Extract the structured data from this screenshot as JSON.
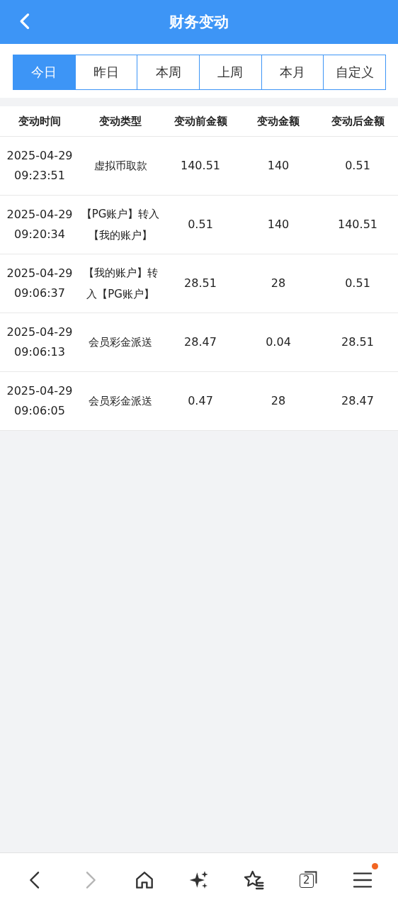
{
  "header": {
    "title": "财务变动"
  },
  "tabs": [
    {
      "label": "今日",
      "selected": true
    },
    {
      "label": "昨日",
      "selected": false
    },
    {
      "label": "本周",
      "selected": false
    },
    {
      "label": "上周",
      "selected": false
    },
    {
      "label": "本月",
      "selected": false
    },
    {
      "label": "自定义",
      "selected": false
    }
  ],
  "table": {
    "columns": [
      "变动时间",
      "变动类型",
      "变动前金额",
      "变动金额",
      "变动后金额"
    ],
    "rows": [
      [
        "2025-04-29 09:23:51",
        "虚拟币取款",
        "140.51",
        "140",
        "0.51"
      ],
      [
        "2025-04-29 09:20:34",
        "【PG账户】转入【我的账户】",
        "0.51",
        "140",
        "140.51"
      ],
      [
        "2025-04-29 09:06:37",
        "【我的账户】转入【PG账户】",
        "28.51",
        "28",
        "0.51"
      ],
      [
        "2025-04-29 09:06:13",
        "会员彩金派送",
        "28.47",
        "0.04",
        "28.51"
      ],
      [
        "2025-04-29 09:06:05",
        "会员彩金派送",
        "0.47",
        "28",
        "28.47"
      ]
    ]
  },
  "toolbar": [
    {
      "kind": "back",
      "disabled": false
    },
    {
      "kind": "forward",
      "disabled": true
    },
    {
      "kind": "home",
      "disabled": false
    },
    {
      "kind": "sparkle",
      "disabled": false
    },
    {
      "kind": "favorites",
      "disabled": false
    },
    {
      "kind": "tabs",
      "disabled": false,
      "count": "2"
    },
    {
      "kind": "menu",
      "disabled": false,
      "badge": true
    }
  ]
}
